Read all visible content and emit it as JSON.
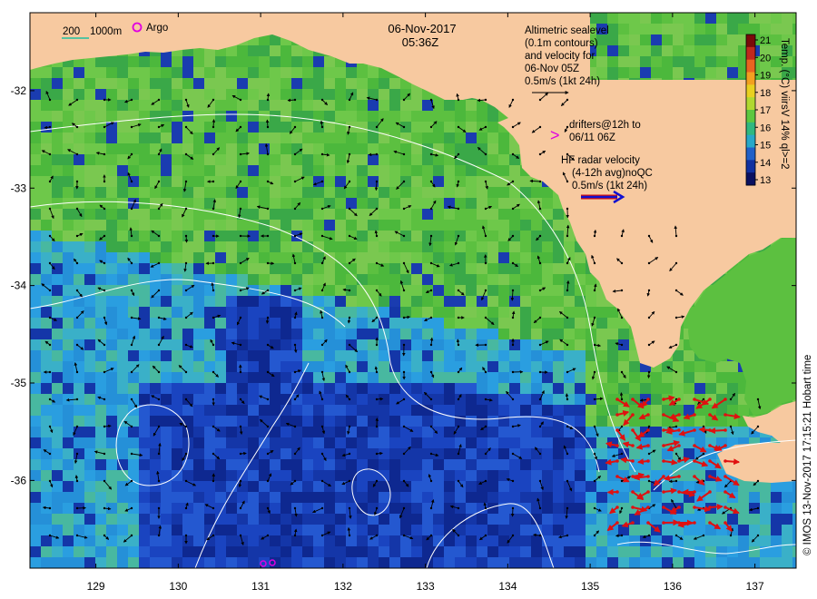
{
  "map": {
    "title_date": "06-Nov-2017",
    "title_time": "05:36Z",
    "credit": "© IMOS 13-Nov-2017 17:15:21 Hobart time",
    "lat_ticks": [
      "-32",
      "-33",
      "-34",
      "-35",
      "-36"
    ],
    "lon_ticks": [
      "129",
      "130",
      "131",
      "132",
      "133",
      "134",
      "135",
      "136",
      "137"
    ],
    "extent": {
      "lon": [
        128.2,
        137.5
      ],
      "lat": [
        -36.9,
        -31.2
      ]
    }
  },
  "legend_topleft": {
    "scale_left": "200",
    "scale_right": "1000m",
    "argo_label": "Argo",
    "argo_color": "#e000e0",
    "scale_color": "#20c0a0"
  },
  "altimetry_note": {
    "lines": [
      "Altimetric sealevel",
      "(0.1m contours)",
      "and velocity for",
      "06-Nov 05Z",
      "0.5m/s (1kt 24h)"
    ]
  },
  "drifter_note": {
    "symbol": ">",
    "lines": [
      "drifters@12h to",
      "06/11 06Z"
    ],
    "color": "#e000e0"
  },
  "hf_note": {
    "lines": [
      "HF radar velocity",
      "(4-12h avg)noQC",
      "0.5m/s (1kt 24h)"
    ],
    "arrow_color": "#1010d0",
    "arrow_outline": "#d01010"
  },
  "colorbar": {
    "label": "Temp. (°C)  viirsV 14% ql>=2",
    "ticks": [
      "21",
      "20",
      "19",
      "18",
      "17",
      "16",
      "15",
      "14",
      "13"
    ],
    "range": [
      13,
      21
    ],
    "colors": [
      "#7a0a0a",
      "#c0281e",
      "#e86420",
      "#f2a020",
      "#e8d020",
      "#b0d830",
      "#5cc840",
      "#30b880",
      "#28a8c8",
      "#2060c8",
      "#1030a0",
      "#0a1060"
    ]
  },
  "colors": {
    "land": "#f7c9a0",
    "warm_sea": "#5cc040",
    "cool_sea": "#2a9ee0",
    "cold_sea": "#1436a8",
    "contour": "#ffffff",
    "radar_arrow": "#e01010",
    "velocity_arrow": "#000000"
  }
}
